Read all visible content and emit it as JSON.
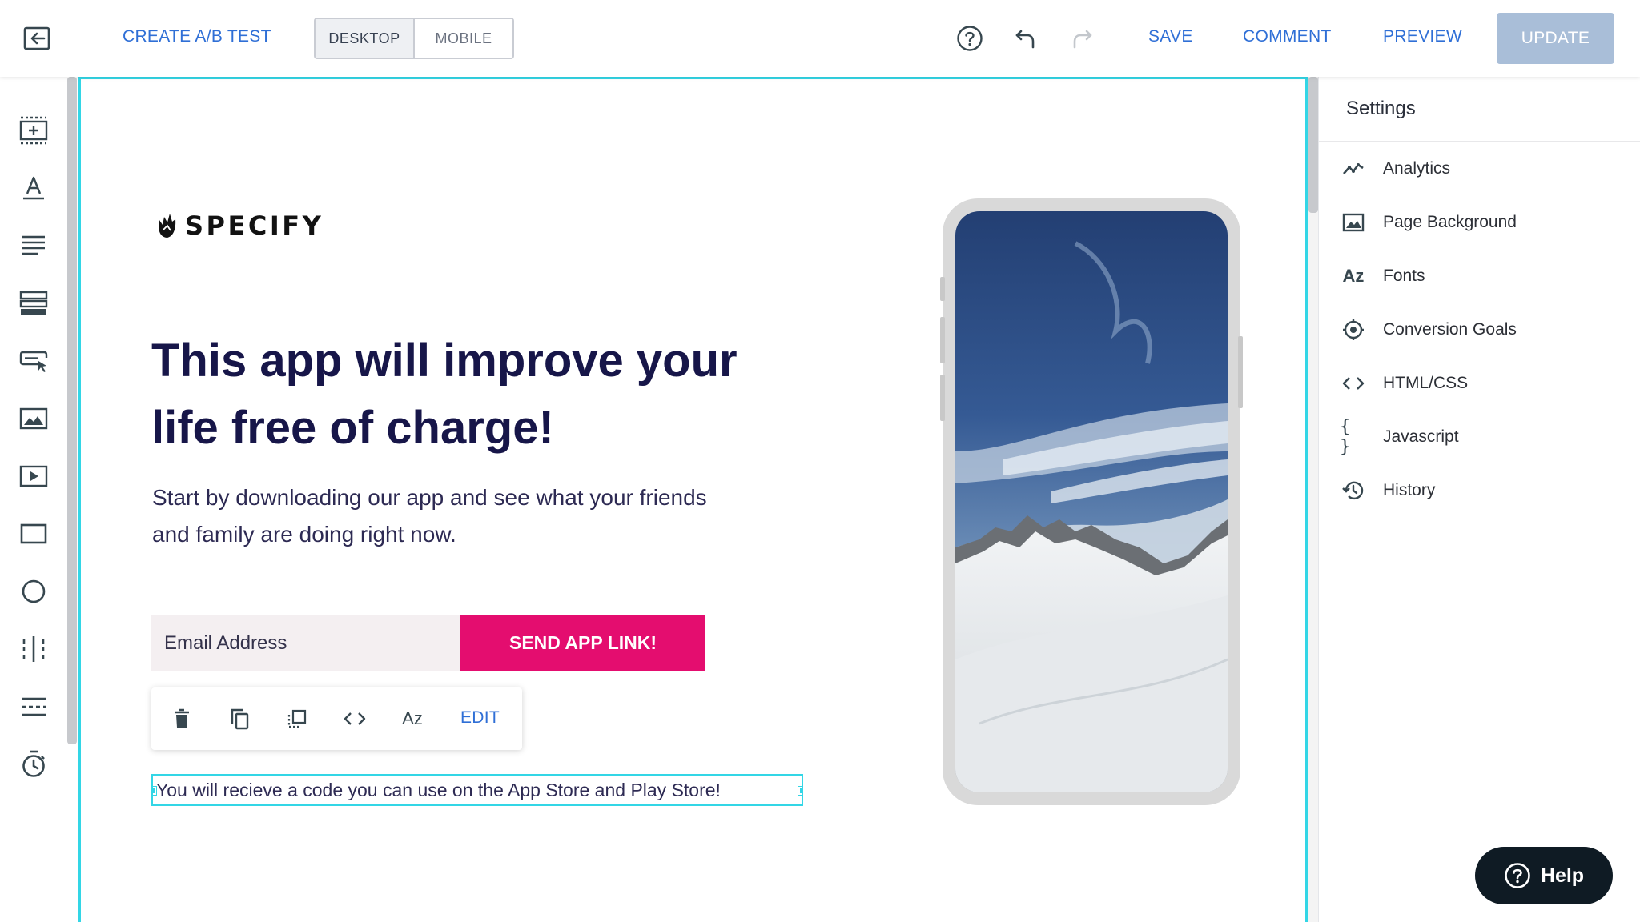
{
  "topbar": {
    "create_ab_test": "CREATE A/B TEST",
    "device_desktop": "DESKTOP",
    "device_mobile": "MOBILE",
    "save": "SAVE",
    "comment": "COMMENT",
    "preview": "PREVIEW",
    "update": "UPDATE"
  },
  "left_tools": [
    "add-section-icon",
    "text-icon",
    "paragraph-icon",
    "form-icon",
    "button-icon",
    "image-icon",
    "video-icon",
    "box-icon",
    "circle-icon",
    "columns-icon",
    "divider-icon",
    "timer-icon"
  ],
  "canvas": {
    "logo_text": "SPECIFY",
    "headline": "This app will improve your life free of charge!",
    "subtext": "Start by downloading our app and see what your friends and family are doing right now.",
    "email_placeholder": "Email Address",
    "send_button": "SEND APP LINK!",
    "element_toolbar": {
      "edit": "EDIT",
      "font": "Az"
    },
    "selected_text": "You will recieve a code you can use on the App Store and Play Store!"
  },
  "settings": {
    "title": "Settings",
    "items": [
      {
        "label": "Analytics",
        "icon": "analytics-icon"
      },
      {
        "label": "Page Background",
        "icon": "image-icon"
      },
      {
        "label": "Fonts",
        "icon": "font-icon"
      },
      {
        "label": "Conversion Goals",
        "icon": "target-icon"
      },
      {
        "label": "HTML/CSS",
        "icon": "code-icon"
      },
      {
        "label": "Javascript",
        "icon": "braces-icon"
      },
      {
        "label": "History",
        "icon": "history-icon"
      }
    ],
    "fonts_icon_text": "Az",
    "javascript_icon_text": "{ }"
  },
  "help": {
    "label": "Help"
  },
  "colors": {
    "accent_link": "#2f6fd6",
    "selection": "#33d6e6",
    "cta": "#e40d6f",
    "headline": "#171649",
    "update_disabled": "#a9bed8"
  }
}
